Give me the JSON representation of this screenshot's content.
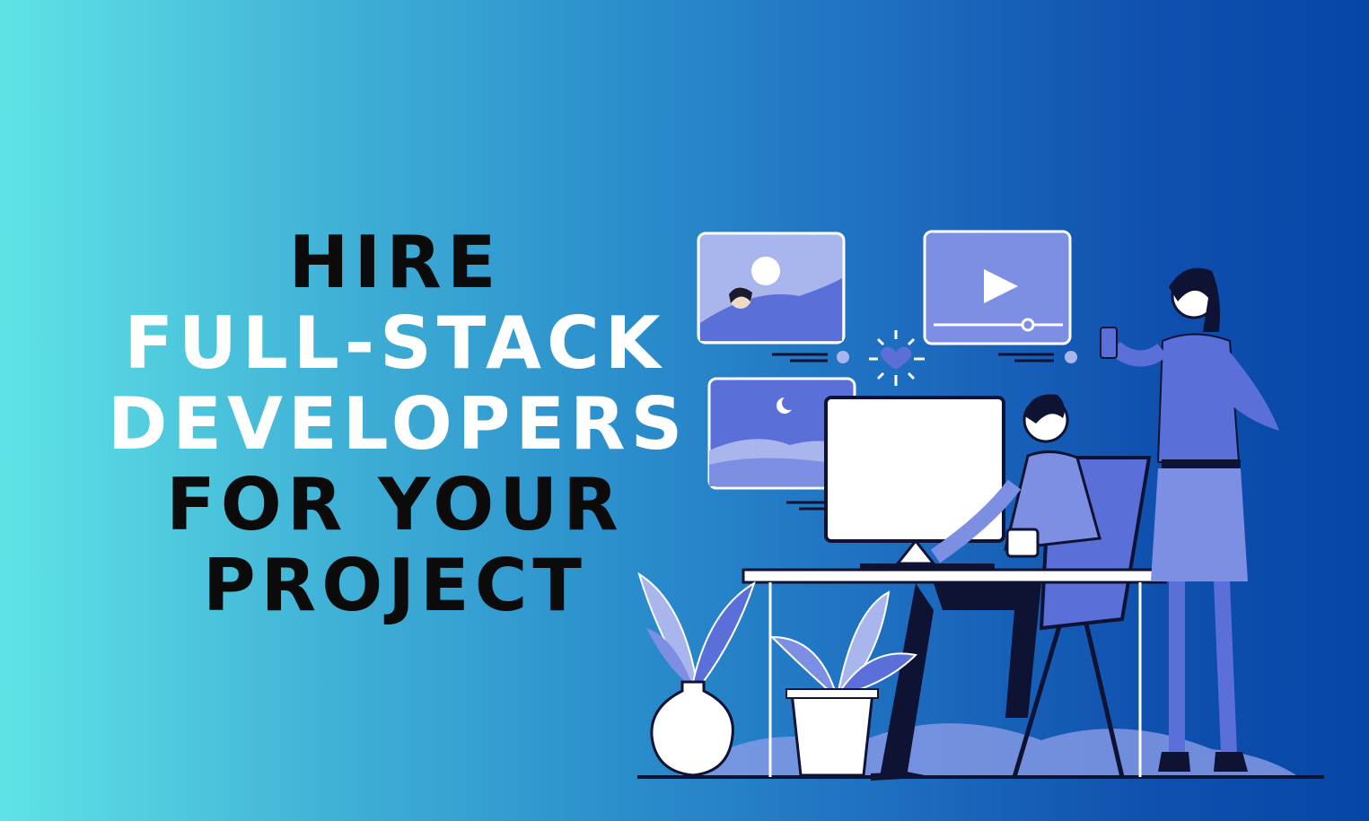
{
  "headline": {
    "line1": "HIRE",
    "line2": "FULL-STACK",
    "line3": "DEVELOPERS",
    "line4": "FOR YOUR",
    "line5": "PROJECT"
  },
  "colors": {
    "gradient_start": "#5fe3e6",
    "gradient_end": "#0646a6",
    "headline_dark": "#0b0b0b",
    "headline_light": "#ffffff",
    "illustration_primary": "#5a6fd8",
    "illustration_light": "#a9b6ee"
  },
  "illustration": {
    "icons": [
      "image-card-icon",
      "video-player-icon",
      "play-icon",
      "heart-icon",
      "night-landscape-card-icon",
      "computer-monitor-icon",
      "plant-icon",
      "vase-icon"
    ]
  }
}
